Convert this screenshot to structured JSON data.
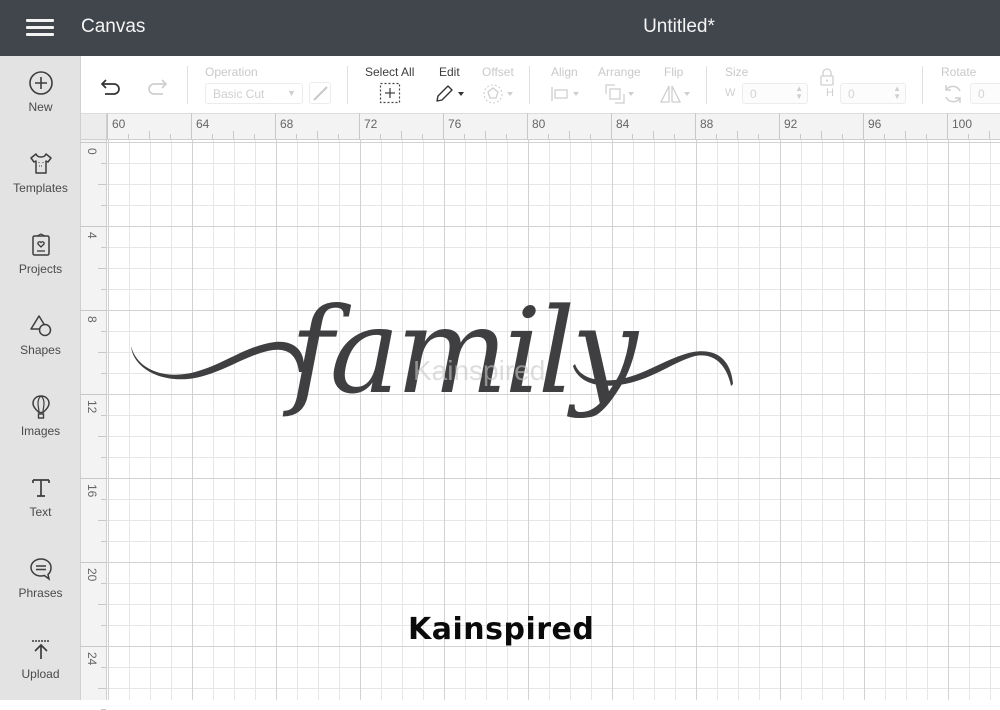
{
  "topbar": {
    "menu_icon": "hamburger-menu-icon",
    "app_title": "Canvas",
    "doc_title": "Untitled*"
  },
  "sidebar": {
    "items": [
      {
        "label": "New",
        "icon": "plus-circle-icon"
      },
      {
        "label": "Templates",
        "icon": "shirt-icon"
      },
      {
        "label": "Projects",
        "icon": "project-card-icon"
      },
      {
        "label": "Shapes",
        "icon": "shapes-icon"
      },
      {
        "label": "Images",
        "icon": "hot-air-balloon-icon"
      },
      {
        "label": "Text",
        "icon": "text-t-icon"
      },
      {
        "label": "Phrases",
        "icon": "speech-bubble-icon"
      },
      {
        "label": "Upload",
        "icon": "upload-icon"
      }
    ]
  },
  "toolbar": {
    "undo_icon": "undo-icon",
    "redo_icon": "redo-icon",
    "operation": {
      "label": "Operation",
      "value": "Basic Cut"
    },
    "select_all": {
      "label": "Select All"
    },
    "edit": {
      "label": "Edit"
    },
    "offset": {
      "label": "Offset"
    },
    "align": {
      "label": "Align"
    },
    "arrange": {
      "label": "Arrange"
    },
    "flip": {
      "label": "Flip"
    },
    "size": {
      "label": "Size",
      "w_label": "W",
      "w_value": "0",
      "h_label": "H",
      "h_value": "0"
    },
    "rotate": {
      "label": "Rotate",
      "value": "0"
    }
  },
  "rulers": {
    "top": [
      "60",
      "64",
      "68",
      "72",
      "76",
      "80",
      "84",
      "88",
      "92",
      "96",
      "100"
    ],
    "left": [
      "0",
      "4",
      "8",
      "12",
      "16",
      "20",
      "24"
    ]
  },
  "canvas": {
    "design_text": "family",
    "design_color": "#3f3f41",
    "faint_watermark": "Kainspired"
  },
  "watermark": "Kainspired"
}
